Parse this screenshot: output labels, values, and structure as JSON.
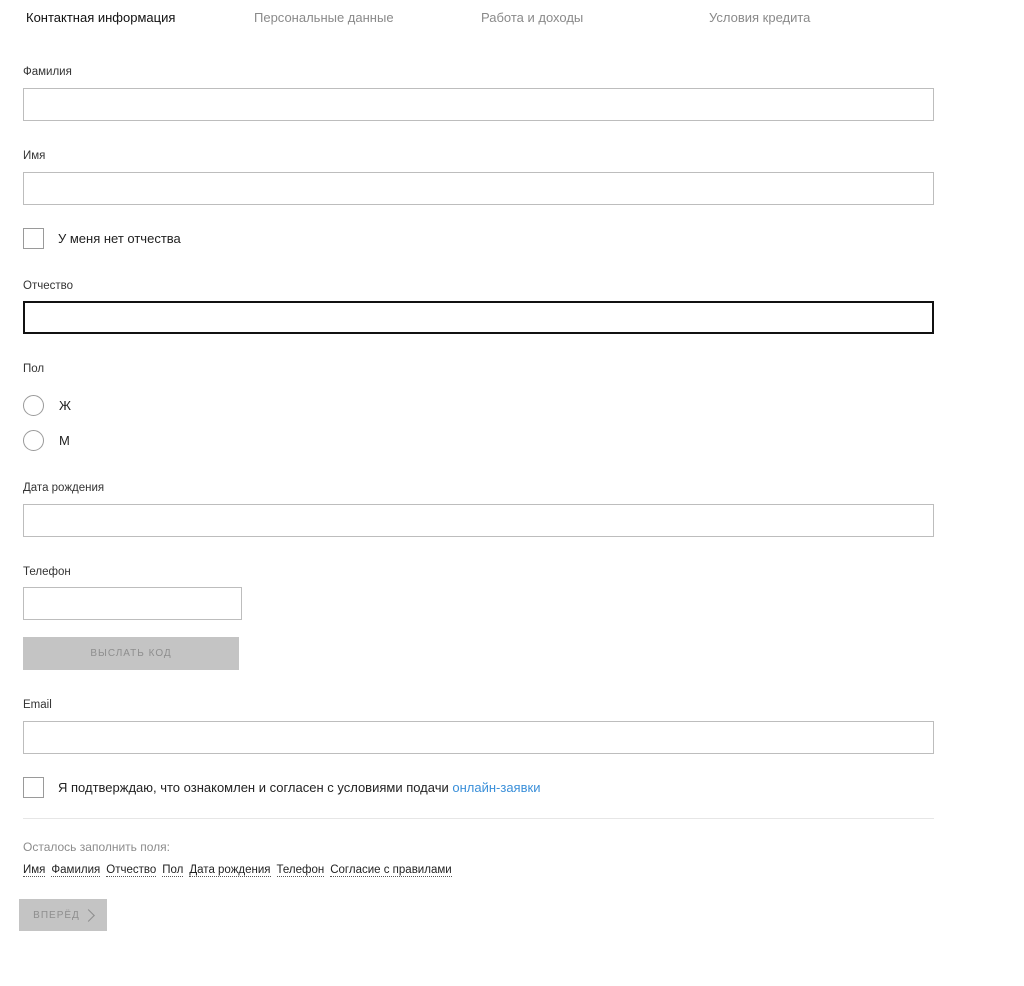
{
  "tabs": [
    {
      "label": "Контактная информация",
      "active": true
    },
    {
      "label": "Персональные данные",
      "active": false
    },
    {
      "label": "Работа и доходы",
      "active": false
    },
    {
      "label": "Условия кредита",
      "active": false
    }
  ],
  "form": {
    "last_name": {
      "label": "Фамилия",
      "value": ""
    },
    "first_name": {
      "label": "Имя",
      "value": ""
    },
    "no_patronymic": {
      "label": "У меня нет отчества",
      "checked": false
    },
    "patronymic": {
      "label": "Отчество",
      "value": ""
    },
    "gender": {
      "label": "Пол",
      "options": [
        {
          "label": "Ж",
          "selected": false
        },
        {
          "label": "М",
          "selected": false
        }
      ]
    },
    "birth_date": {
      "label": "Дата рождения",
      "value": ""
    },
    "phone": {
      "label": "Телефон",
      "value": ""
    },
    "send_code_button": "ВЫСЛАТЬ КОД",
    "email": {
      "label": "Email",
      "value": ""
    },
    "agreement": {
      "text": "Я подтверждаю, что ознакомлен и согласен с условиями подачи",
      "link_text": "онлайн-заявки",
      "checked": false
    }
  },
  "remaining": {
    "title": "Осталось заполнить поля:",
    "fields": [
      "Имя",
      "Фамилия",
      "Отчество",
      "Пол",
      "Дата рождения",
      "Телефон",
      "Согласие с правилами"
    ]
  },
  "next_button": "ВПЕРЁД",
  "colors": {
    "link": "#3a8fd9",
    "disabled_button": "#c4c4c4",
    "field_border": "#bdbdbd",
    "focused_border": "#111111"
  }
}
